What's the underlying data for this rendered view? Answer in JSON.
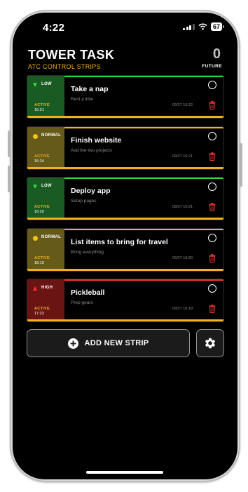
{
  "status_bar": {
    "time": "4:22",
    "battery": "67"
  },
  "header": {
    "title": "TOWER TASK",
    "subtitle": "ATC CONTROL STRIPS",
    "future_count": "0",
    "future_label": "FUTURE"
  },
  "tasks": [
    {
      "priority": "LOW",
      "priority_icon": "triangle-down-icon",
      "priority_color": "#1a5a23",
      "top_color": "#2ddc3a",
      "status": "ACTIVE",
      "status_time": "16:21",
      "title": "Take a nap",
      "description": "Rest a little",
      "date": "09/27 16:22"
    },
    {
      "priority": "NORMAL",
      "priority_icon": "dot-icon",
      "priority_color": "#655a1a",
      "top_color": "#f2b01e",
      "status": "ACTIVE",
      "status_time": "16:24",
      "title": "Finish website",
      "description": "Add the two projects",
      "date": "09/27 16:21"
    },
    {
      "priority": "LOW",
      "priority_icon": "triangle-down-icon",
      "priority_color": "#1a5a23",
      "top_color": "#2ddc3a",
      "status": "ACTIVE",
      "status_time": "16:20",
      "title": "Deploy app",
      "description": "Setup pages",
      "date": "09/27 16:21"
    },
    {
      "priority": "NORMAL",
      "priority_icon": "dot-icon",
      "priority_color": "#655a1a",
      "top_color": "#f2b01e",
      "status": "ACTIVE",
      "status_time": "18:19",
      "title": "List items to bring for travel",
      "description": "Bring everything",
      "date": "09/27 16:20"
    },
    {
      "priority": "HIGH",
      "priority_icon": "triangle-up-icon",
      "priority_color": "#6b1414",
      "top_color": "#ff3030",
      "status": "ACTIVE",
      "status_time": "17:23",
      "title": "Pickleball",
      "description": "Prep gears",
      "date": "09/27 16:19"
    }
  ],
  "actions": {
    "add_label": "ADD NEW STRIP",
    "add_icon": "plus-circle-icon",
    "settings_icon": "gear-icon"
  },
  "colors": {
    "accent": "#f2b01e",
    "trash": "#e53935",
    "background": "#000000"
  }
}
